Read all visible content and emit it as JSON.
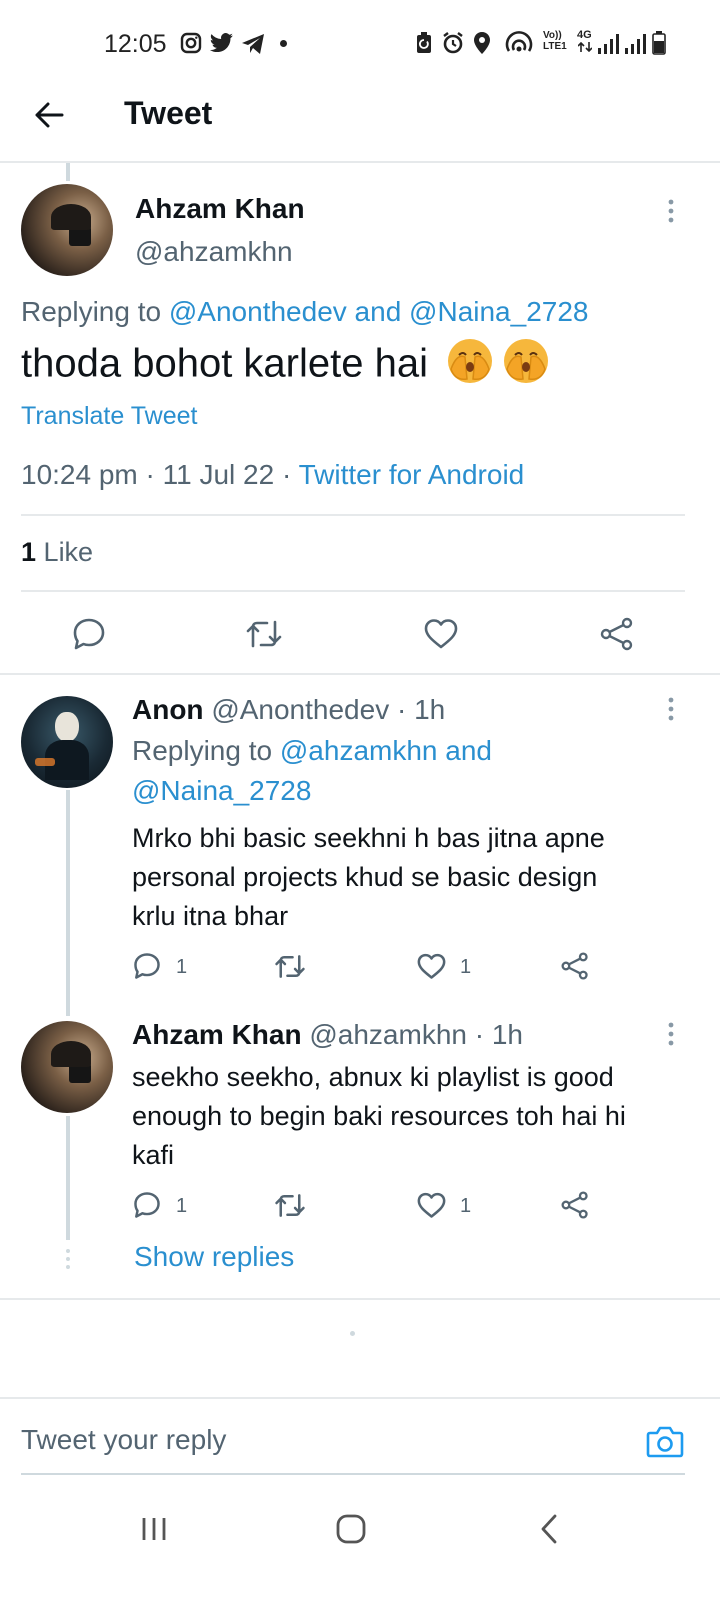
{
  "status_bar": {
    "time": "12:05",
    "network": "4G",
    "volte": "Vo)) LTE1"
  },
  "header": {
    "title": "Tweet"
  },
  "main_tweet": {
    "author_name": "Ahzam Khan",
    "handle": "@ahzamkhn",
    "replying_prefix": "Replying to",
    "replying_user1": "@Anonthedev",
    "replying_and": "and",
    "replying_user2": "@Naina_2728",
    "text": "thoda bohot karlete hai",
    "emoji": "🫣🫣",
    "translate": "Translate Tweet",
    "time": "10:24 pm",
    "date": "11 Jul 22",
    "source": "Twitter for Android",
    "likes_count": "1",
    "likes_label": "Like"
  },
  "replies": [
    {
      "author_name": "Anon",
      "handle": "@Anonthedev",
      "age": "1h",
      "replying_prefix": "Replying to",
      "replying_line1": "@ahzamkhn and",
      "replying_line2": "@Naina_2728",
      "text_lines": [
        "Mrko bhi basic seekhni h bas jitna apne",
        "personal projects khud se basic design",
        "krlu itna bhar"
      ],
      "reply_count": "1",
      "like_count": "1"
    },
    {
      "author_name": "Ahzam Khan",
      "handle": "@ahzamkhn",
      "age": "1h",
      "text_lines": [
        "seekho seekho, abnux ki playlist is good",
        "enough to begin baki resources toh hai hi",
        "kafi"
      ],
      "reply_count": "1",
      "like_count": "1"
    }
  ],
  "show_replies": "Show replies",
  "compose": {
    "placeholder": "Tweet your reply"
  },
  "colors": {
    "accent": "#1d9bf0",
    "text": "#0f1419",
    "secondary": "#536471"
  }
}
